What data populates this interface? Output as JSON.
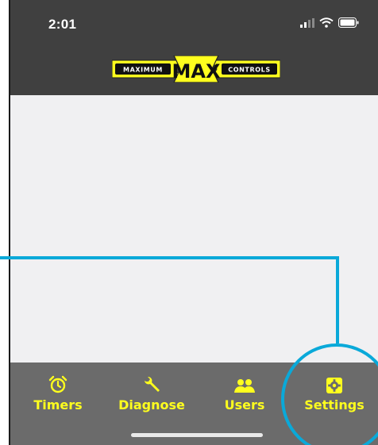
{
  "status_bar": {
    "time": "2:01"
  },
  "logo": {
    "left_word": "MAXIMUM",
    "center_word": "MAX",
    "right_word": "CONTROLS"
  },
  "tabs": [
    {
      "label": "Timers",
      "icon": "alarm-clock-icon"
    },
    {
      "label": "Diagnose",
      "icon": "wrench-icon"
    },
    {
      "label": "Users",
      "icon": "users-icon"
    },
    {
      "label": "Settings",
      "icon": "gear-icon"
    }
  ],
  "colors": {
    "header": "#404040",
    "tabbar": "#6b6b6b",
    "accent_yellow": "#ffff1e",
    "content_bg": "#f0f0f2",
    "annotation_blue": "#0aa9d9"
  }
}
